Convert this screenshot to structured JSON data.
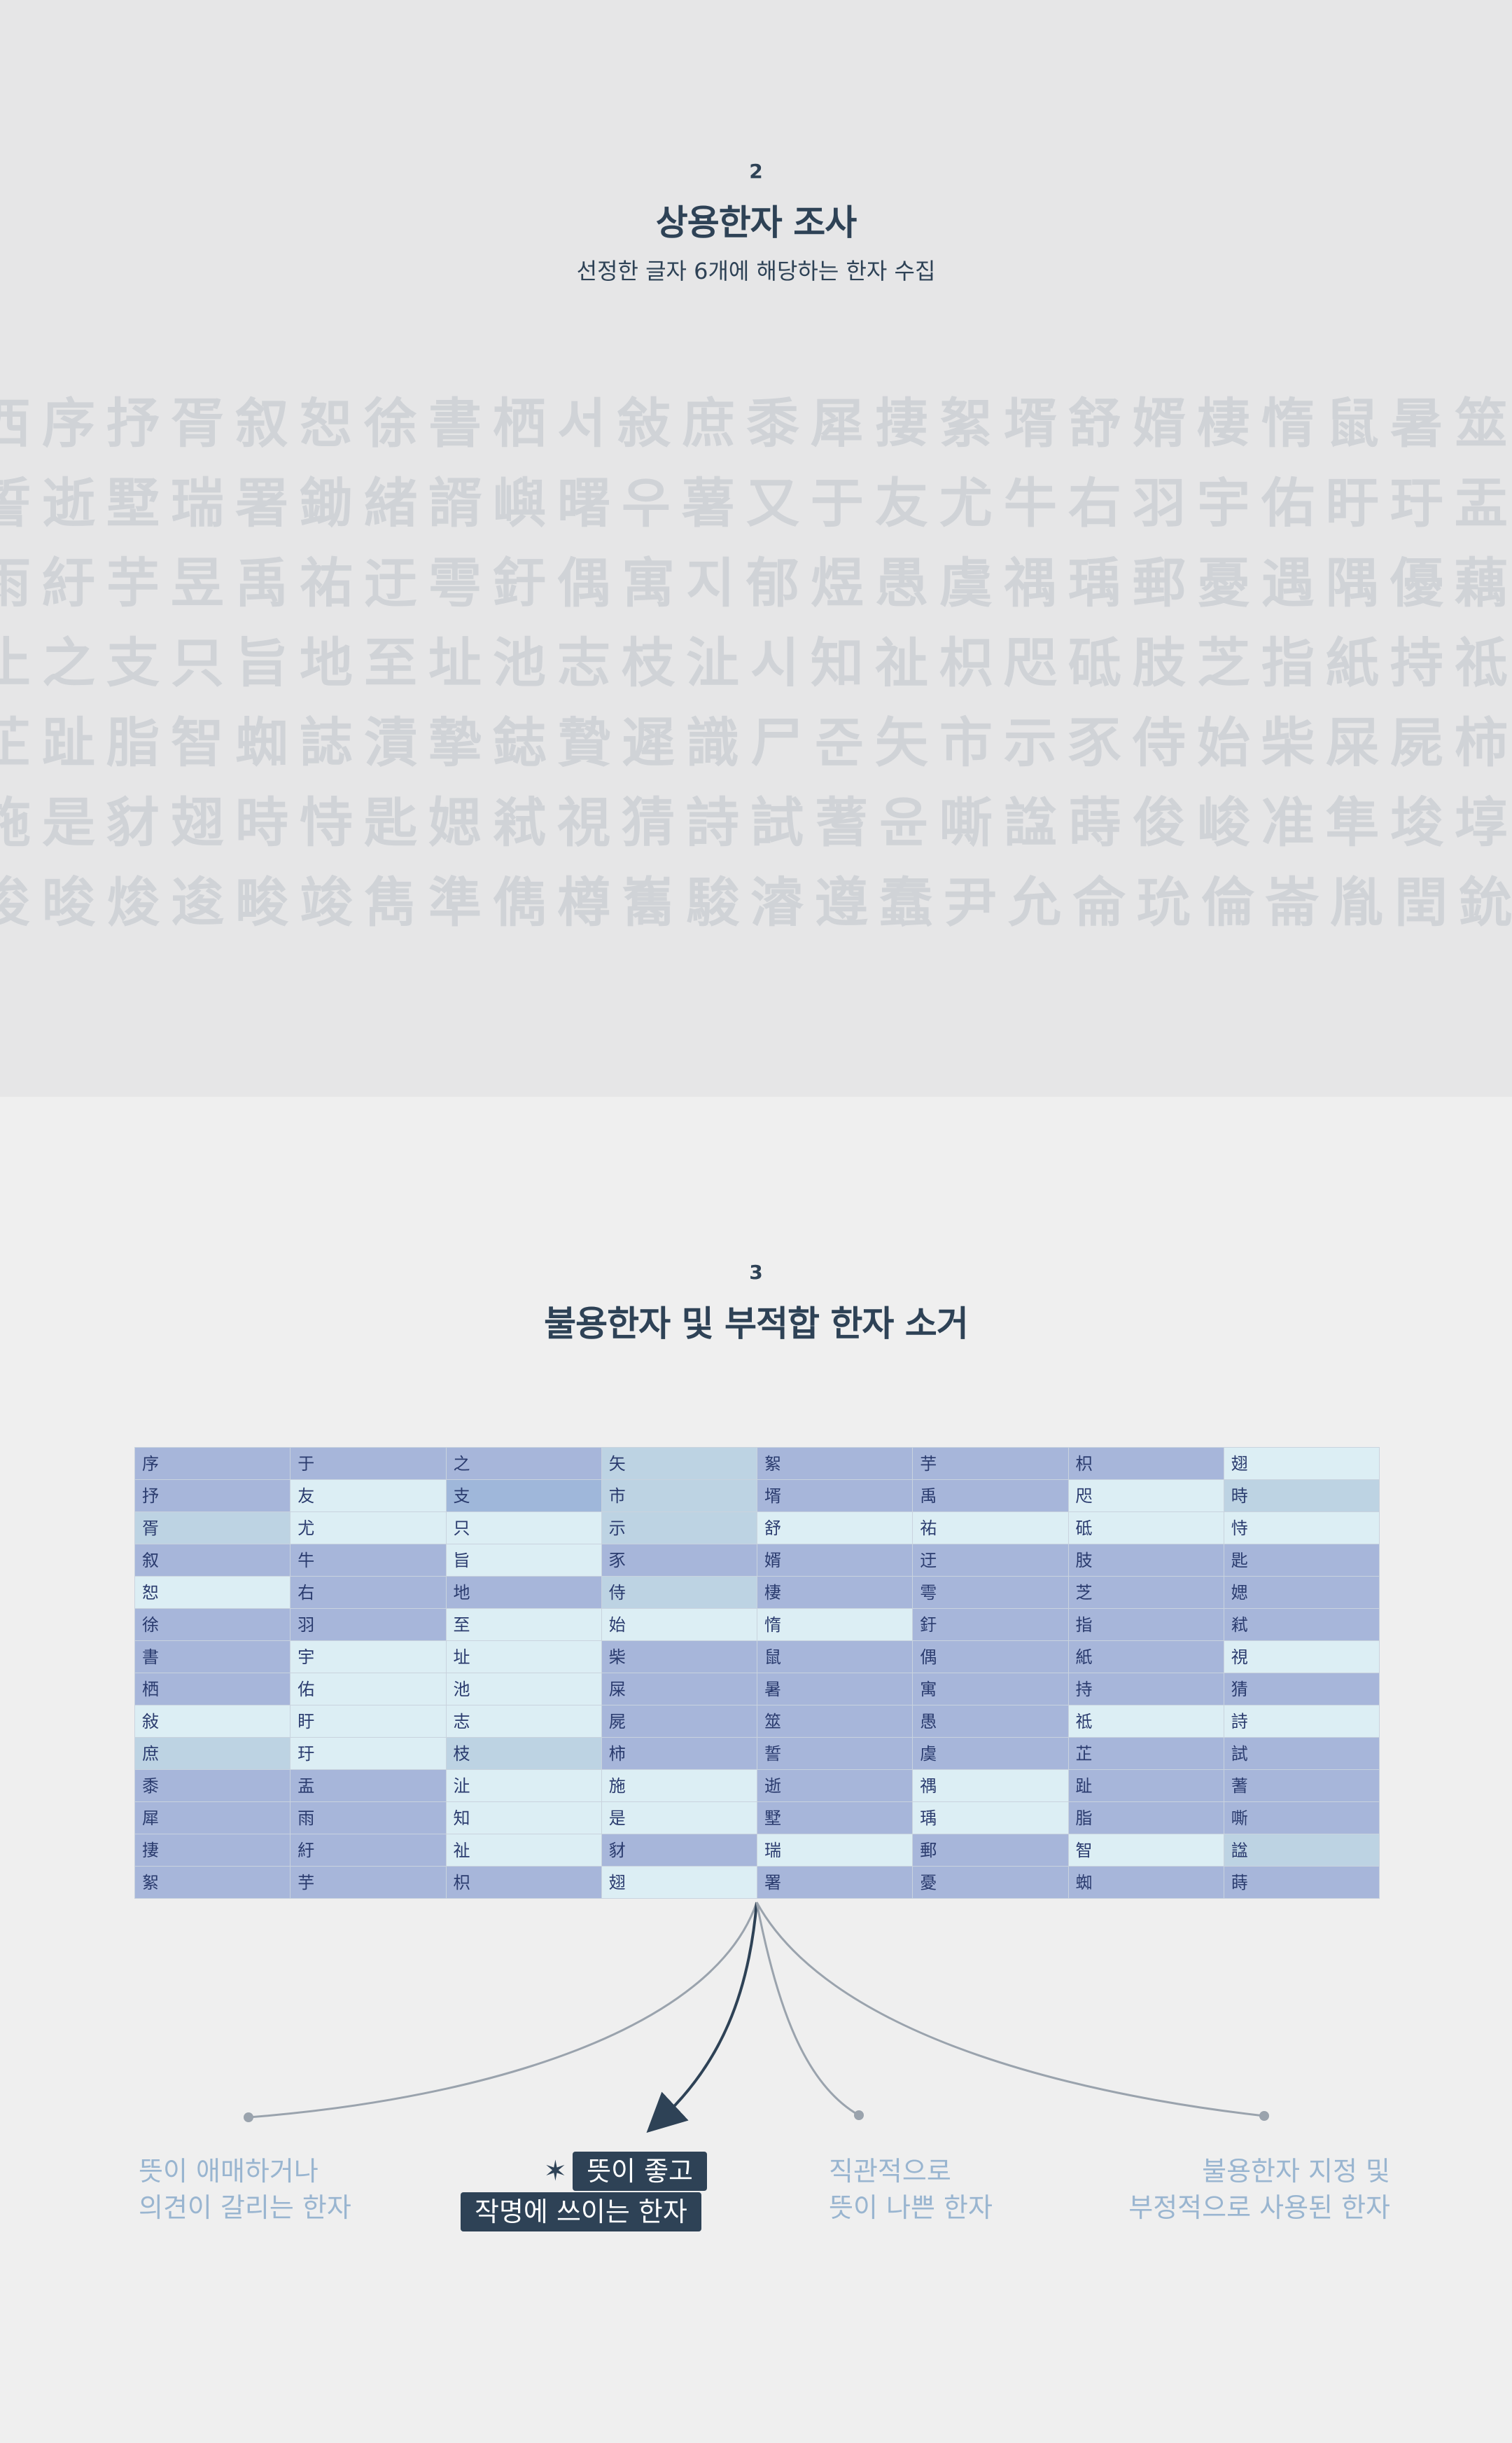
{
  "section2": {
    "number": "2",
    "title": "상용한자 조사",
    "subtitle": "선정한 글자 6개에 해당하는 한자 수집",
    "background_rows": [
      "西序抒胥叙恕徐書栖서敍庶黍犀捿絮壻舒婿棲惰鼠暑筮",
      "誓逝墅瑞署鋤緒諝嶼曙우薯又于友尤牛右羽宇佑盱玗盂",
      "雨紆芋昱禹祐迂雩釪偶寓지郁煜愚虞禑瑀郵憂遇隅優藕",
      "止之支只旨地至址池志枝沚시知祉枳咫砥肢芝指紙持祗",
      "芷趾脂智蜘誌漬摯鋕贄遲識尸준矢市示豕侍始柴屎屍柿",
      "施是豺翅時恃匙媤弒視猜詩試蓍윤嘶諡蒔俊峻准隼埈埻",
      "浚晙焌逡畯竣雋準儁樽雟駿濬遵蠢尹允侖玧倫崙胤閏鈗"
    ]
  },
  "section3": {
    "number": "3",
    "title": "불용한자 및 부적합 한자 소거",
    "table_columns": [
      {
        "cells": [
          "序",
          "抒",
          "胥",
          "叙",
          "恕",
          "徐",
          "書",
          "栖",
          "敍",
          "庶",
          "黍",
          "犀",
          "捿",
          "絮"
        ],
        "shades": [
          1,
          1,
          3,
          1,
          2,
          1,
          1,
          1,
          2,
          3,
          1,
          1,
          1,
          1
        ]
      },
      {
        "cells": [
          "于",
          "友",
          "尤",
          "牛",
          "右",
          "羽",
          "宇",
          "佑",
          "盱",
          "玗",
          "盂",
          "雨",
          "紆",
          "芋"
        ],
        "shades": [
          1,
          2,
          2,
          1,
          1,
          1,
          2,
          2,
          2,
          2,
          1,
          1,
          1,
          1
        ]
      },
      {
        "cells": [
          "之",
          "支",
          "只",
          "旨",
          "地",
          "至",
          "址",
          "池",
          "志",
          "枝",
          "沚",
          "知",
          "祉",
          "枳"
        ],
        "shades": [
          1,
          4,
          2,
          2,
          1,
          2,
          2,
          2,
          2,
          3,
          2,
          2,
          2,
          1
        ]
      },
      {
        "cells": [
          "矢",
          "市",
          "示",
          "豕",
          "侍",
          "始",
          "柴",
          "屎",
          "屍",
          "柿",
          "施",
          "是",
          "豺",
          "翅"
        ],
        "shades": [
          3,
          3,
          3,
          1,
          3,
          2,
          1,
          1,
          1,
          1,
          2,
          2,
          1,
          2
        ]
      },
      {
        "cells": [
          "絮",
          "壻",
          "舒",
          "婿",
          "棲",
          "惰",
          "鼠",
          "暑",
          "筮",
          "誓",
          "逝",
          "墅",
          "瑞",
          "署"
        ],
        "shades": [
          1,
          1,
          2,
          1,
          1,
          2,
          1,
          1,
          1,
          1,
          1,
          1,
          2,
          1
        ]
      },
      {
        "cells": [
          "芋",
          "禹",
          "祐",
          "迂",
          "雩",
          "釪",
          "偶",
          "寓",
          "愚",
          "虞",
          "禑",
          "瑀",
          "郵",
          "憂"
        ],
        "shades": [
          1,
          1,
          2,
          1,
          1,
          1,
          1,
          1,
          1,
          1,
          2,
          2,
          1,
          1
        ]
      },
      {
        "cells": [
          "枳",
          "咫",
          "砥",
          "肢",
          "芝",
          "指",
          "紙",
          "持",
          "祗",
          "芷",
          "趾",
          "脂",
          "智",
          "蜘"
        ],
        "shades": [
          1,
          2,
          2,
          1,
          1,
          1,
          1,
          1,
          2,
          1,
          1,
          1,
          2,
          1
        ]
      },
      {
        "cells": [
          "翅",
          "時",
          "恃",
          "匙",
          "媤",
          "弒",
          "視",
          "猜",
          "詩",
          "試",
          "蓍",
          "嘶",
          "諡",
          "蒔"
        ],
        "shades": [
          2,
          3,
          2,
          1,
          1,
          1,
          2,
          1,
          2,
          1,
          1,
          1,
          3,
          1
        ]
      }
    ],
    "outcomes": [
      {
        "lines": [
          "뜻이 애매하거나",
          "의견이 갈리는 한자"
        ]
      },
      {
        "lines": [
          "뜻이 좋고",
          "작명에 쓰이는 한자"
        ],
        "highlight_icon": "star-icon"
      },
      {
        "lines": [
          "직관적으로",
          "뜻이 나쁜 한자"
        ]
      },
      {
        "lines": [
          "불용한자 지정 및",
          "부정적으로 사용된 한자"
        ]
      }
    ]
  },
  "colors": {
    "dark_navy": "#2e4256",
    "muted_blue_text": "#99b5d0",
    "cell_mid": "#a7b6da",
    "cell_light": "#dceef4",
    "cell_pale": "#bdd3e3",
    "bg_section2": "#e6e6e7",
    "bg_section3": "#efefef"
  }
}
